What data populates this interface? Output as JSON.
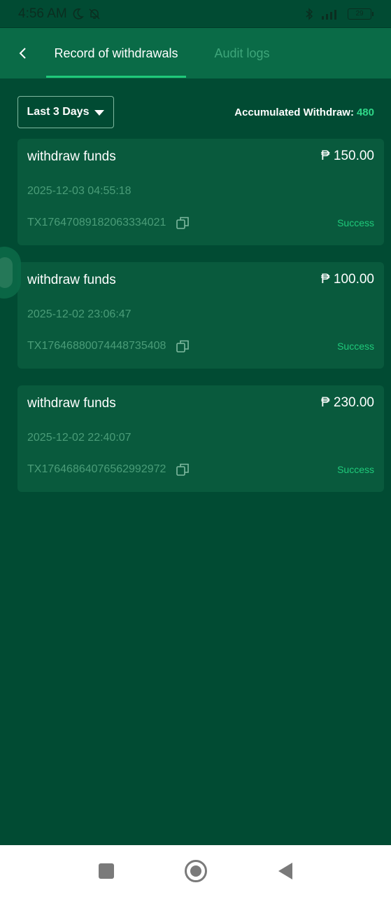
{
  "status_bar": {
    "time": "4:56 AM",
    "battery": "29"
  },
  "header": {
    "tabs": [
      {
        "label": "Record of withdrawals",
        "active": true
      },
      {
        "label": "Audit logs",
        "active": false
      }
    ]
  },
  "filter": {
    "range_label": "Last 3 Days",
    "accumulated_label": "Accumulated Withdraw:",
    "accumulated_value": "480"
  },
  "records": [
    {
      "title": "withdraw funds",
      "amount": "₱ 150.00",
      "datetime": "2025-12-03 04:55:18",
      "tx": "TX17647089182063334021",
      "status": "Success"
    },
    {
      "title": "withdraw funds",
      "amount": "₱ 100.00",
      "datetime": "2025-12-02 23:06:47",
      "tx": "TX17646880074448735408",
      "status": "Success"
    },
    {
      "title": "withdraw funds",
      "amount": "₱ 230.00",
      "datetime": "2025-12-02 22:40:07",
      "tx": "TX17646864076562992972",
      "status": "Success"
    }
  ],
  "colors": {
    "background": "#014b33",
    "header": "#0a6b47",
    "card": "#095a3d",
    "accent": "#1fc97a",
    "muted_text": "#4a9c78"
  }
}
